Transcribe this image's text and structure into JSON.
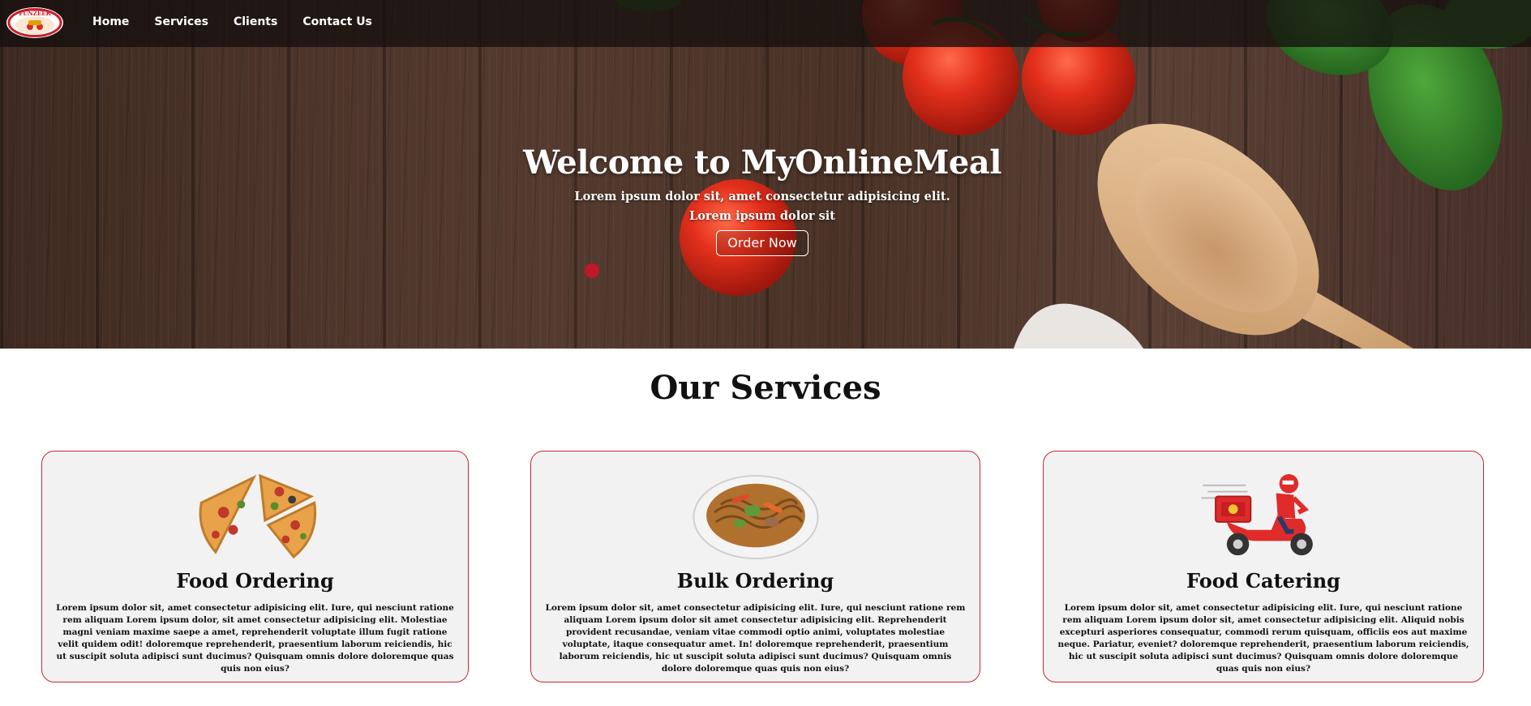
{
  "nav": {
    "logo_text": "FUNZEEK",
    "links": [
      "Home",
      "Services",
      "Clients",
      "Contact Us"
    ]
  },
  "hero": {
    "title": "Welcome to MyOnlineMeal",
    "subtitle_line1": "Lorem ipsum dolor sit, amet consectetur adipisicing elit.",
    "subtitle_line2": "Lorem ipsum dolor sit",
    "button_label": "Order Now"
  },
  "services": {
    "heading": "Our Services",
    "cards": [
      {
        "title": "Food Ordering",
        "image": "pizza-image",
        "text": "Lorem ipsum dolor sit, amet consectetur adipisicing elit. Iure, qui nesciunt ratione rem aliquam Lorem ipsum dolor, sit amet consectetur adipisicing elit. Molestiae magni veniam maxime saepe a amet, reprehenderit voluptate illum fugit ratione velit quidem odit! doloremque reprehenderit, praesentium laborum reiciendis, hic ut suscipit soluta adipisci sunt ducimus? Quisquam omnis dolore doloremque quas quis non eius?"
      },
      {
        "title": "Bulk Ordering",
        "image": "noodles-image",
        "text": "Lorem ipsum dolor sit, amet consectetur adipisicing elit. Iure, qui nesciunt ratione rem aliquam Lorem ipsum dolor sit amet consectetur adipisicing elit. Reprehenderit provident recusandae, veniam vitae commodi optio animi, voluptates molestiae voluptate, itaque consequatur amet. In! doloremque reprehenderit, praesentium laborum reiciendis, hic ut suscipit soluta adipisci sunt ducimus? Quisquam omnis dolore doloremque quas quis non eius?"
      },
      {
        "title": "Food Catering",
        "image": "delivery-scooter-image",
        "text": "Lorem ipsum dolor sit, amet consectetur adipisicing elit. Iure, qui nesciunt ratione rem aliquam Lorem ipsum dolor sit, amet consectetur adipisicing elit. Aliquid nobis excepturi asperiores consequatur, commodi rerum quisquam, officiis eos aut maxime neque. Pariatur, eveniet? doloremque reprehenderit, praesentium laborum reiciendis, hic ut suscipit soluta adipisci sunt ducimus? Quisquam omnis dolore doloremque quas quis non eius?"
      }
    ]
  },
  "colors": {
    "card_border": "#c22b33",
    "card_bg": "#f2f2f2",
    "navbar_bg": "#14100e"
  }
}
